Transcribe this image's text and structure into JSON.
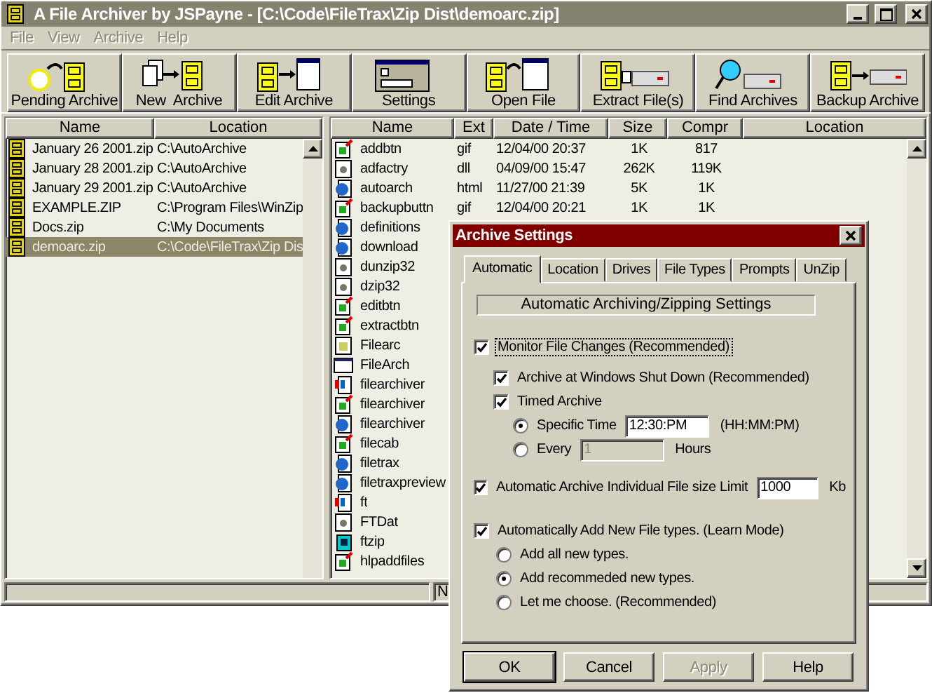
{
  "window": {
    "title": "A File Archiver by JSPayne - [C:\\Code\\FileTrax\\Zip Dist\\demoarc.zip]"
  },
  "menu": [
    {
      "label": "File",
      "disabled": true
    },
    {
      "label": "View",
      "disabled": true
    },
    {
      "label": "Archive",
      "disabled": true
    },
    {
      "label": "Help",
      "disabled": true
    }
  ],
  "toolbar": [
    {
      "kind": "pending",
      "label": "Pending Archive"
    },
    {
      "kind": "new",
      "label": "New  Archive"
    },
    {
      "kind": "edit",
      "label": "Edit Archive"
    },
    {
      "kind": "settings",
      "label": "Settings"
    },
    {
      "kind": "open",
      "label": "Open File"
    },
    {
      "kind": "extract",
      "label": "Extract File(s)"
    },
    {
      "kind": "find",
      "label": "Find Archives"
    },
    {
      "kind": "backup",
      "label": "Backup Archive"
    }
  ],
  "archives": {
    "columns": [
      "Name",
      "Location"
    ],
    "rows": [
      {
        "name": "January 26 2001.zip",
        "location": "C:\\AutoArchive",
        "selected": false
      },
      {
        "name": "January 28 2001.zip",
        "location": "C:\\AutoArchive",
        "selected": false
      },
      {
        "name": "January 29 2001.zip",
        "location": "C:\\AutoArchive",
        "selected": false
      },
      {
        "name": "EXAMPLE.ZIP",
        "location": "C:\\Program Files\\WinZip",
        "selected": false
      },
      {
        "name": "Docs.zip",
        "location": "C:\\My Documents",
        "selected": false
      },
      {
        "name": "demoarc.zip",
        "location": "C:\\Code\\FileTrax\\Zip Dis",
        "selected": true
      }
    ]
  },
  "files": {
    "columns": [
      "Name",
      "Ext",
      "Date / Time",
      "Size",
      "Compr",
      "Location"
    ],
    "rows": [
      {
        "kind": "image",
        "name": "addbtn",
        "ext": "gif",
        "date": "12/04/00  20:37",
        "size": "1K",
        "compr": "817"
      },
      {
        "kind": "system",
        "name": "adfactry",
        "ext": "dll",
        "date": "04/09/00  15:47",
        "size": "262K",
        "compr": "119K"
      },
      {
        "kind": "web",
        "name": "autoarch",
        "ext": "html",
        "date": "11/27/00  21:39",
        "size": "5K",
        "compr": "1K"
      },
      {
        "kind": "image",
        "name": "backupbuttn",
        "ext": "gif",
        "date": "12/04/00  20:21",
        "size": "1K",
        "compr": "1K"
      },
      {
        "kind": "web",
        "name": "definitions"
      },
      {
        "kind": "web",
        "name": "download"
      },
      {
        "kind": "system",
        "name": "dunzip32"
      },
      {
        "kind": "system",
        "name": "dzip32"
      },
      {
        "kind": "image",
        "name": "editbtn"
      },
      {
        "kind": "image",
        "name": "extractbtn"
      },
      {
        "kind": "text",
        "name": "Filearc"
      },
      {
        "kind": "form",
        "name": "FileArch"
      },
      {
        "kind": "project",
        "name": "filearchiver"
      },
      {
        "kind": "image",
        "name": "filearchiver"
      },
      {
        "kind": "web",
        "name": "filearchiver"
      },
      {
        "kind": "image",
        "name": "filecab"
      },
      {
        "kind": "web",
        "name": "filetrax"
      },
      {
        "kind": "web",
        "name": "filetraxpreview"
      },
      {
        "kind": "project",
        "name": "ft"
      },
      {
        "kind": "system",
        "name": "FTDat"
      },
      {
        "kind": "zip",
        "name": "ftzip"
      },
      {
        "kind": "image",
        "name": "hlpaddfiles"
      }
    ]
  },
  "status_bar": {
    "text": "N"
  },
  "dialog": {
    "title": "Archive Settings",
    "tabs": [
      {
        "label": "Automatic",
        "selected": true
      },
      {
        "label": "Location",
        "selected": false
      },
      {
        "label": "Drives",
        "selected": false
      },
      {
        "label": "File Types",
        "selected": false
      },
      {
        "label": "Prompts",
        "selected": false
      },
      {
        "label": "UnZip",
        "selected": false
      }
    ],
    "heading": "Automatic Archiving/Zipping Settings",
    "options": [
      {
        "kind": "checkbox",
        "label": "Monitor File Changes  (Recommended)",
        "checked": true,
        "children": [
          {
            "kind": "checkbox",
            "label": "Archive at Windows Shut Down  (Recommended)",
            "checked": true
          },
          {
            "kind": "checkbox",
            "label": "Timed Archive",
            "checked": true,
            "children": [
              {
                "kind": "radio",
                "label": "Specific Time",
                "selected": true,
                "field": "12:30:PM",
                "field_disabled": false,
                "suffix": "(HH:MM:PM)"
              },
              {
                "kind": "radio",
                "label": "Every",
                "selected": false,
                "field": "1",
                "field_disabled": true,
                "suffix": "Hours"
              }
            ]
          }
        ]
      },
      {
        "kind": "checkbox",
        "label": "Automatic Archive Individual File size Limit",
        "checked": true,
        "field": "1000",
        "field_disabled": false,
        "suffix": "Kb"
      },
      {
        "kind": "checkbox",
        "label": "Automatically Add New File types. (Learn Mode)",
        "checked": true,
        "children": [
          {
            "kind": "radio",
            "label": "Add all new types.",
            "selected": false
          },
          {
            "kind": "radio",
            "label": "Add recommeded new types.",
            "selected": true
          },
          {
            "kind": "radio",
            "label": "Let me choose. (Recommended)",
            "selected": false
          }
        ]
      }
    ],
    "buttons": [
      {
        "label": "OK",
        "disabled": false
      },
      {
        "label": "Cancel",
        "disabled": false
      },
      {
        "label": "Apply",
        "disabled": true
      },
      {
        "label": "Help",
        "disabled": false
      }
    ]
  }
}
